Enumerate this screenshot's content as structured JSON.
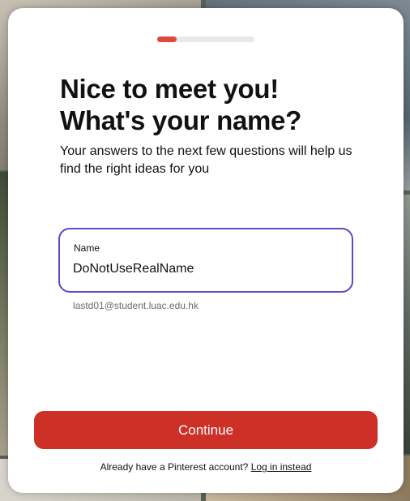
{
  "progress": {
    "fraction": 0.2
  },
  "heading": {
    "line1": "Nice to meet you!",
    "line2": "What's your name?"
  },
  "subtitle": "Your answers to the next few questions will help us find the right ideas for you",
  "name_field": {
    "label": "Name",
    "value": "DoNotUseRealName"
  },
  "helper_email": "lastd01@student.luac.edu.hk",
  "continue_label": "Continue",
  "footer": {
    "prompt": "Already have a Pinterest account?",
    "login_link": "Log in instead"
  },
  "colors": {
    "accent_red": "#cd3027",
    "progress_red": "#e0483e",
    "focus_border": "#5b4bc4"
  }
}
